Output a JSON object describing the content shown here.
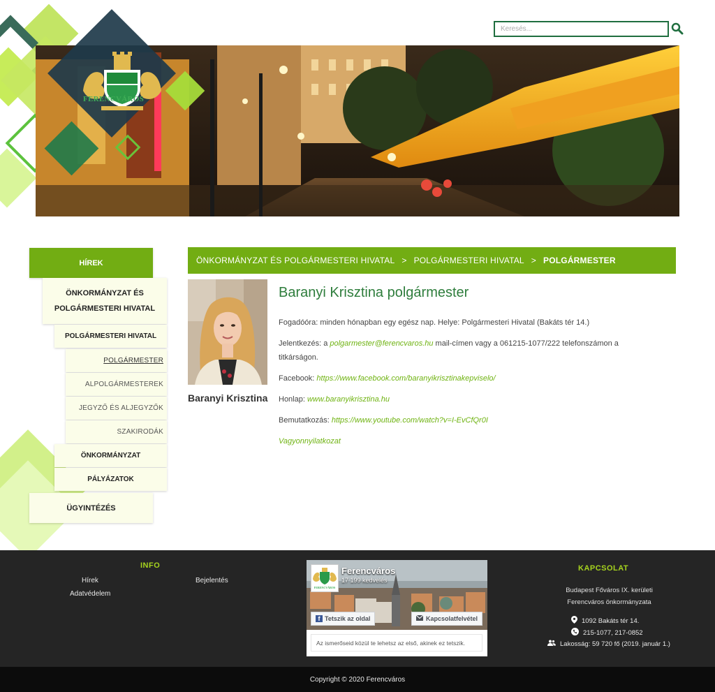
{
  "search": {
    "placeholder": "Keresés..."
  },
  "logo": {
    "text": "FERENCVÁROS"
  },
  "sidebar": {
    "items": [
      {
        "label": "HÍREK"
      },
      {
        "label": "ÖNKORMÁNYZAT ÉS POLGÁRMESTERI HIVATAL"
      },
      {
        "label": "POLGÁRMESTERI HIVATAL"
      },
      {
        "label": "POLGÁRMESTER"
      },
      {
        "label": "ALPOLGÁRMESTEREK"
      },
      {
        "label": "JEGYZŐ ÉS ALJEGYZŐK"
      },
      {
        "label": "SZAKIRODÁK"
      },
      {
        "label": "ÖNKORMÁNYZAT"
      },
      {
        "label": "PÁLYÁZATOK"
      },
      {
        "label": "ÜGYINTÉZÉS"
      }
    ]
  },
  "breadcrumb": {
    "items": [
      "ÖNKORMÁNYZAT ÉS POLGÁRMESTERI HIVATAL",
      "POLGÁRMESTERI HIVATAL",
      "POLGÁRMESTER"
    ],
    "separator": ">"
  },
  "profile": {
    "caption": "Baranyi Krisztina",
    "title": "Baranyi Krisztina polgármester",
    "office_hours": "Fogadóóra: minden hónapban egy egész nap. Helye: Polgármesteri Hivatal (Bakáts tér 14.)",
    "apply_prefix": "Jelentkezés: a ",
    "apply_email": "polgarmester@ferencvaros.hu",
    "apply_suffix": " mail-címen vagy a 061215-1077/222 telefonszámon a titkárságon.",
    "facebook_label": "Facebook: ",
    "facebook_url": "https://www.facebook.com/baranyikrisztinakepviselo/",
    "homepage_label": "Honlap: ",
    "homepage_url": "www.baranyikrisztina.hu",
    "intro_label": "Bemutatkozás: ",
    "intro_url": "https://www.youtube.com/watch?v=I-EvCfQr0I",
    "assets_link": "Vagyonnyilatkozat"
  },
  "footer": {
    "info_heading": "INFO",
    "info_links": [
      "Hírek",
      "Bejelentés",
      "Adatvédelem"
    ],
    "contact_heading": "KAPCSOLAT",
    "org_line1": "Budapest Főváros IX. kerületi",
    "org_line2": "Ferencváros önkormányzata",
    "address": "1092 Bakáts tér 14.",
    "phone": "215-1077, 217-0852",
    "population": "Lakosság: 59 720 fő (2019. január 1.)",
    "copyright": "Copyright © 2020 Ferencváros"
  },
  "facebook_widget": {
    "page_name": "Ferencváros",
    "likes": "17 199 kedvelés",
    "like_button": "Tetszik az oldal",
    "contact_button": "Kapcsolatfelvétel",
    "friends_text": "Az ismerőseid közül te lehetsz az első, akinek ez tetszik.",
    "logo_text": "FERENCVÁROS"
  },
  "colors": {
    "brand_green": "#72ad13",
    "dark_green": "#2e7d3c",
    "lime": "#a6d31e",
    "footer_bg": "#252525"
  },
  "icons": {
    "search": "search-icon",
    "pin": "map-pin-icon",
    "phone": "phone-icon",
    "people": "people-icon",
    "facebook": "facebook-icon",
    "mail": "mail-icon"
  }
}
